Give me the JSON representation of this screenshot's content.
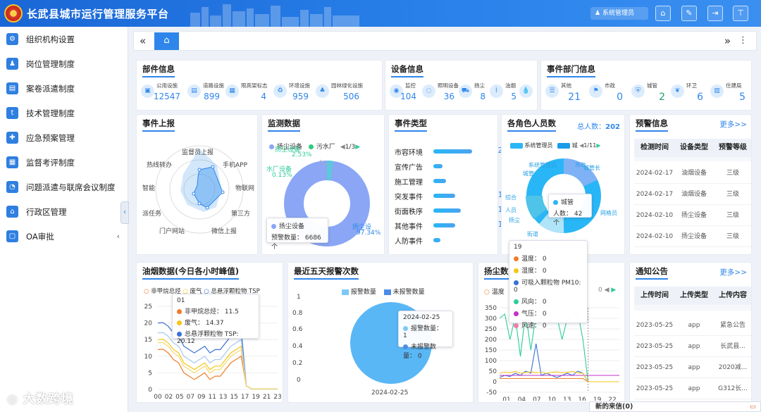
{
  "header": {
    "title": "长武县城市运行管理服务平台",
    "user": "系统管理员",
    "buttons": [
      "⌂",
      "✎",
      "⇥",
      "⊤"
    ]
  },
  "sidebar": {
    "items": [
      {
        "label": "组织机构设置",
        "icon": "⚙"
      },
      {
        "label": "岗位管理制度",
        "icon": "♟"
      },
      {
        "label": "案卷派遣制度",
        "icon": "▤"
      },
      {
        "label": "技术管理制度",
        "icon": "t"
      },
      {
        "label": "应急预案管理",
        "icon": "✚"
      },
      {
        "label": "监督考评制度",
        "icon": "▦"
      },
      {
        "label": "问题派遣与联席会议制度",
        "icon": "◔"
      },
      {
        "label": "行政区管理",
        "icon": "⌂"
      },
      {
        "label": "OA审批",
        "icon": "▢"
      }
    ],
    "collapse": "‹"
  },
  "tabbar": {
    "left": "«",
    "right": "»",
    "menu": "⋮"
  },
  "parts": {
    "title": "部件信息",
    "items": [
      {
        "label": "公用设施",
        "value": "12547"
      },
      {
        "label": "道路设施",
        "value": "899"
      },
      {
        "label": "限高架标志",
        "value": "4"
      },
      {
        "label": "环境设施",
        "value": "959"
      },
      {
        "label": "园林绿化设施",
        "value": "506"
      }
    ]
  },
  "devices": {
    "title": "设备信息",
    "items": [
      {
        "label": "监控",
        "value": "104"
      },
      {
        "label": "照明设备",
        "value": "36"
      },
      {
        "label": "扬尘",
        "value": "8"
      },
      {
        "label": "油烟",
        "value": "5"
      }
    ]
  },
  "depts": {
    "title": "事件部门信息",
    "items": [
      {
        "label": "其他",
        "value": "21"
      },
      {
        "label": "市政",
        "value": "0"
      },
      {
        "label": "城管",
        "value": "2"
      },
      {
        "label": "环卫",
        "value": "6"
      },
      {
        "label": "住建局",
        "value": "5"
      }
    ]
  },
  "report": {
    "title": "事件上报",
    "labels": [
      "监督员上报",
      "手机APP",
      "物联网",
      "第三方",
      "微信上报",
      "门户网站",
      "派任务",
      "智能",
      "热线转办"
    ]
  },
  "monitor": {
    "title": "监测数据",
    "legend": [
      "扬尘设备",
      "污水厂"
    ],
    "page": "1/3",
    "top_label": "扬尘设备",
    "top_pct": "2.53%",
    "left_label": "水厂设备",
    "left_pct": "0.13%",
    "right_label": "扬尘设",
    "right_pct": "97.34%",
    "tip_name": "扬尘设备",
    "tip_text": "预警数量：  6686个"
  },
  "evtype": {
    "title": "事件类型",
    "rows": [
      {
        "name": "市容环境",
        "value": "21",
        "pct": 1
      },
      {
        "name": "宣传广告",
        "value": "5",
        "pct": 0.24
      },
      {
        "name": "施工管理",
        "value": "7",
        "pct": 0.33
      },
      {
        "name": "突发事件",
        "value": "12",
        "pct": 0.57
      },
      {
        "name": "街面秩序",
        "value": "15",
        "pct": 0.71
      },
      {
        "name": "其他事件",
        "value": "12",
        "pct": 0.57
      },
      {
        "name": "人防事件",
        "value": "4",
        "pct": 0.19
      }
    ]
  },
  "roles": {
    "title": "各角色人员数",
    "total_label": "总人数：",
    "total": "202",
    "legend": [
      "系统管理员",
      "城"
    ],
    "page": "1/11",
    "tip_name": "城管",
    "tip_text": "人数：  42个",
    "outer_labels": [
      "系统管理员",
      "市政",
      "城管",
      "综合",
      "街道",
      "城管",
      "人员",
      "扬尘",
      "网格员",
      "城管长"
    ]
  },
  "warn": {
    "title": "预警信息",
    "more": "更多>>",
    "cols": [
      "检测时间",
      "设备类型",
      "预警等级"
    ],
    "rows": [
      [
        "2024-02-17",
        "油烟设备",
        "三级"
      ],
      [
        "2024-02-17",
        "油烟设备",
        "三级"
      ],
      [
        "2024-02-10",
        "扬尘设备",
        "三级"
      ],
      [
        "2024-02-10",
        "扬尘设备",
        "三级"
      ]
    ]
  },
  "oil": {
    "title": "油烟数据(今日各小时峰值)",
    "legend": [
      "非甲烷总烃",
      "废气",
      "总悬浮颗粒物 TSP"
    ],
    "yticks": [
      "0",
      "5",
      "10",
      "15",
      "20",
      "25"
    ],
    "xticks": [
      "00",
      "02",
      "05",
      "07",
      "09",
      "11",
      "13",
      "15",
      "17",
      "19",
      "21",
      "23"
    ],
    "tip_head": "01",
    "tip": [
      {
        "label": "非甲烷总烃：  11.5",
        "color": "#f07c2a"
      },
      {
        "label": "废气：  14.37",
        "color": "#f5c518"
      },
      {
        "label": "总悬浮颗粒物 TSP:  20.12",
        "color": "#3a6fd8"
      }
    ]
  },
  "alarm": {
    "title": "最近五天报警次数",
    "legend": [
      "报警数量",
      "未报警数量"
    ],
    "yticks": [
      "0",
      "0.2",
      "0.4",
      "0.6",
      "0.8",
      "1"
    ],
    "x": "2024-02-25",
    "tip_head": "2024-02-25",
    "tip": [
      "报警数量：  1",
      "未报警数量：  0"
    ]
  },
  "dust": {
    "title": "扬尘数",
    "legend": "温度",
    "yticks": [
      "-50",
      "0",
      "50",
      "100",
      "150",
      "200",
      "250",
      "300",
      "350"
    ],
    "xticks": [
      "01",
      "04",
      "07",
      "10",
      "13",
      "16",
      "19",
      "22"
    ],
    "tip_head": "19",
    "tip": [
      {
        "label": "温度：  0",
        "color": "#f07c2a"
      },
      {
        "label": "湿度：  0",
        "color": "#f5c518"
      },
      {
        "label": "可吸入颗粒物 PM10:  0",
        "color": "#3a6fd8"
      },
      {
        "label": "风向：  0",
        "color": "#2ecc9a"
      },
      {
        "label": "气压：  0",
        "color": "#c230c8"
      },
      {
        "label": "风速：  0",
        "color": "#f07caa"
      }
    ],
    "page": "0"
  },
  "notice": {
    "title": "通知公告",
    "more": "更多>>",
    "cols": [
      "上传时间",
      "上传类型",
      "上传内容"
    ],
    "rows": [
      [
        "2023-05-25",
        "app",
        "紧急公告"
      ],
      [
        "2023-05-25",
        "app",
        "长武县..."
      ],
      [
        "2023-05-25",
        "app",
        "2020减..."
      ],
      [
        "2023-05-25",
        "app",
        "G312长..."
      ]
    ]
  },
  "mail": "新的来信(0)",
  "watermark": "大数跨境"
}
